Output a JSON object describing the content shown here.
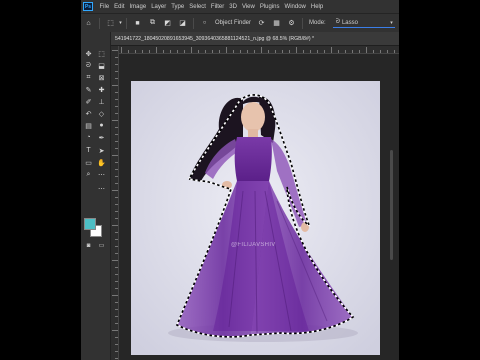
{
  "menu": {
    "logo": "Ps",
    "items": [
      "File",
      "Edit",
      "Image",
      "Layer",
      "Type",
      "Select",
      "Filter",
      "3D",
      "View",
      "Plugins",
      "Window",
      "Help"
    ]
  },
  "options_bar": {
    "object_finder_label": "Object Finder",
    "mode_label": "Mode:",
    "mode_value": "Lasso"
  },
  "document": {
    "tab_title": "541941722_18045020891653945_3093640365881124521_n.jpg @ 68.5% (RGB/8#) *"
  },
  "colors": {
    "foreground": "#4dbec4",
    "background": "#ffffff",
    "accent": "#3b7ee8"
  },
  "canvas": {
    "watermark": "@FILIJAVSHIV"
  }
}
